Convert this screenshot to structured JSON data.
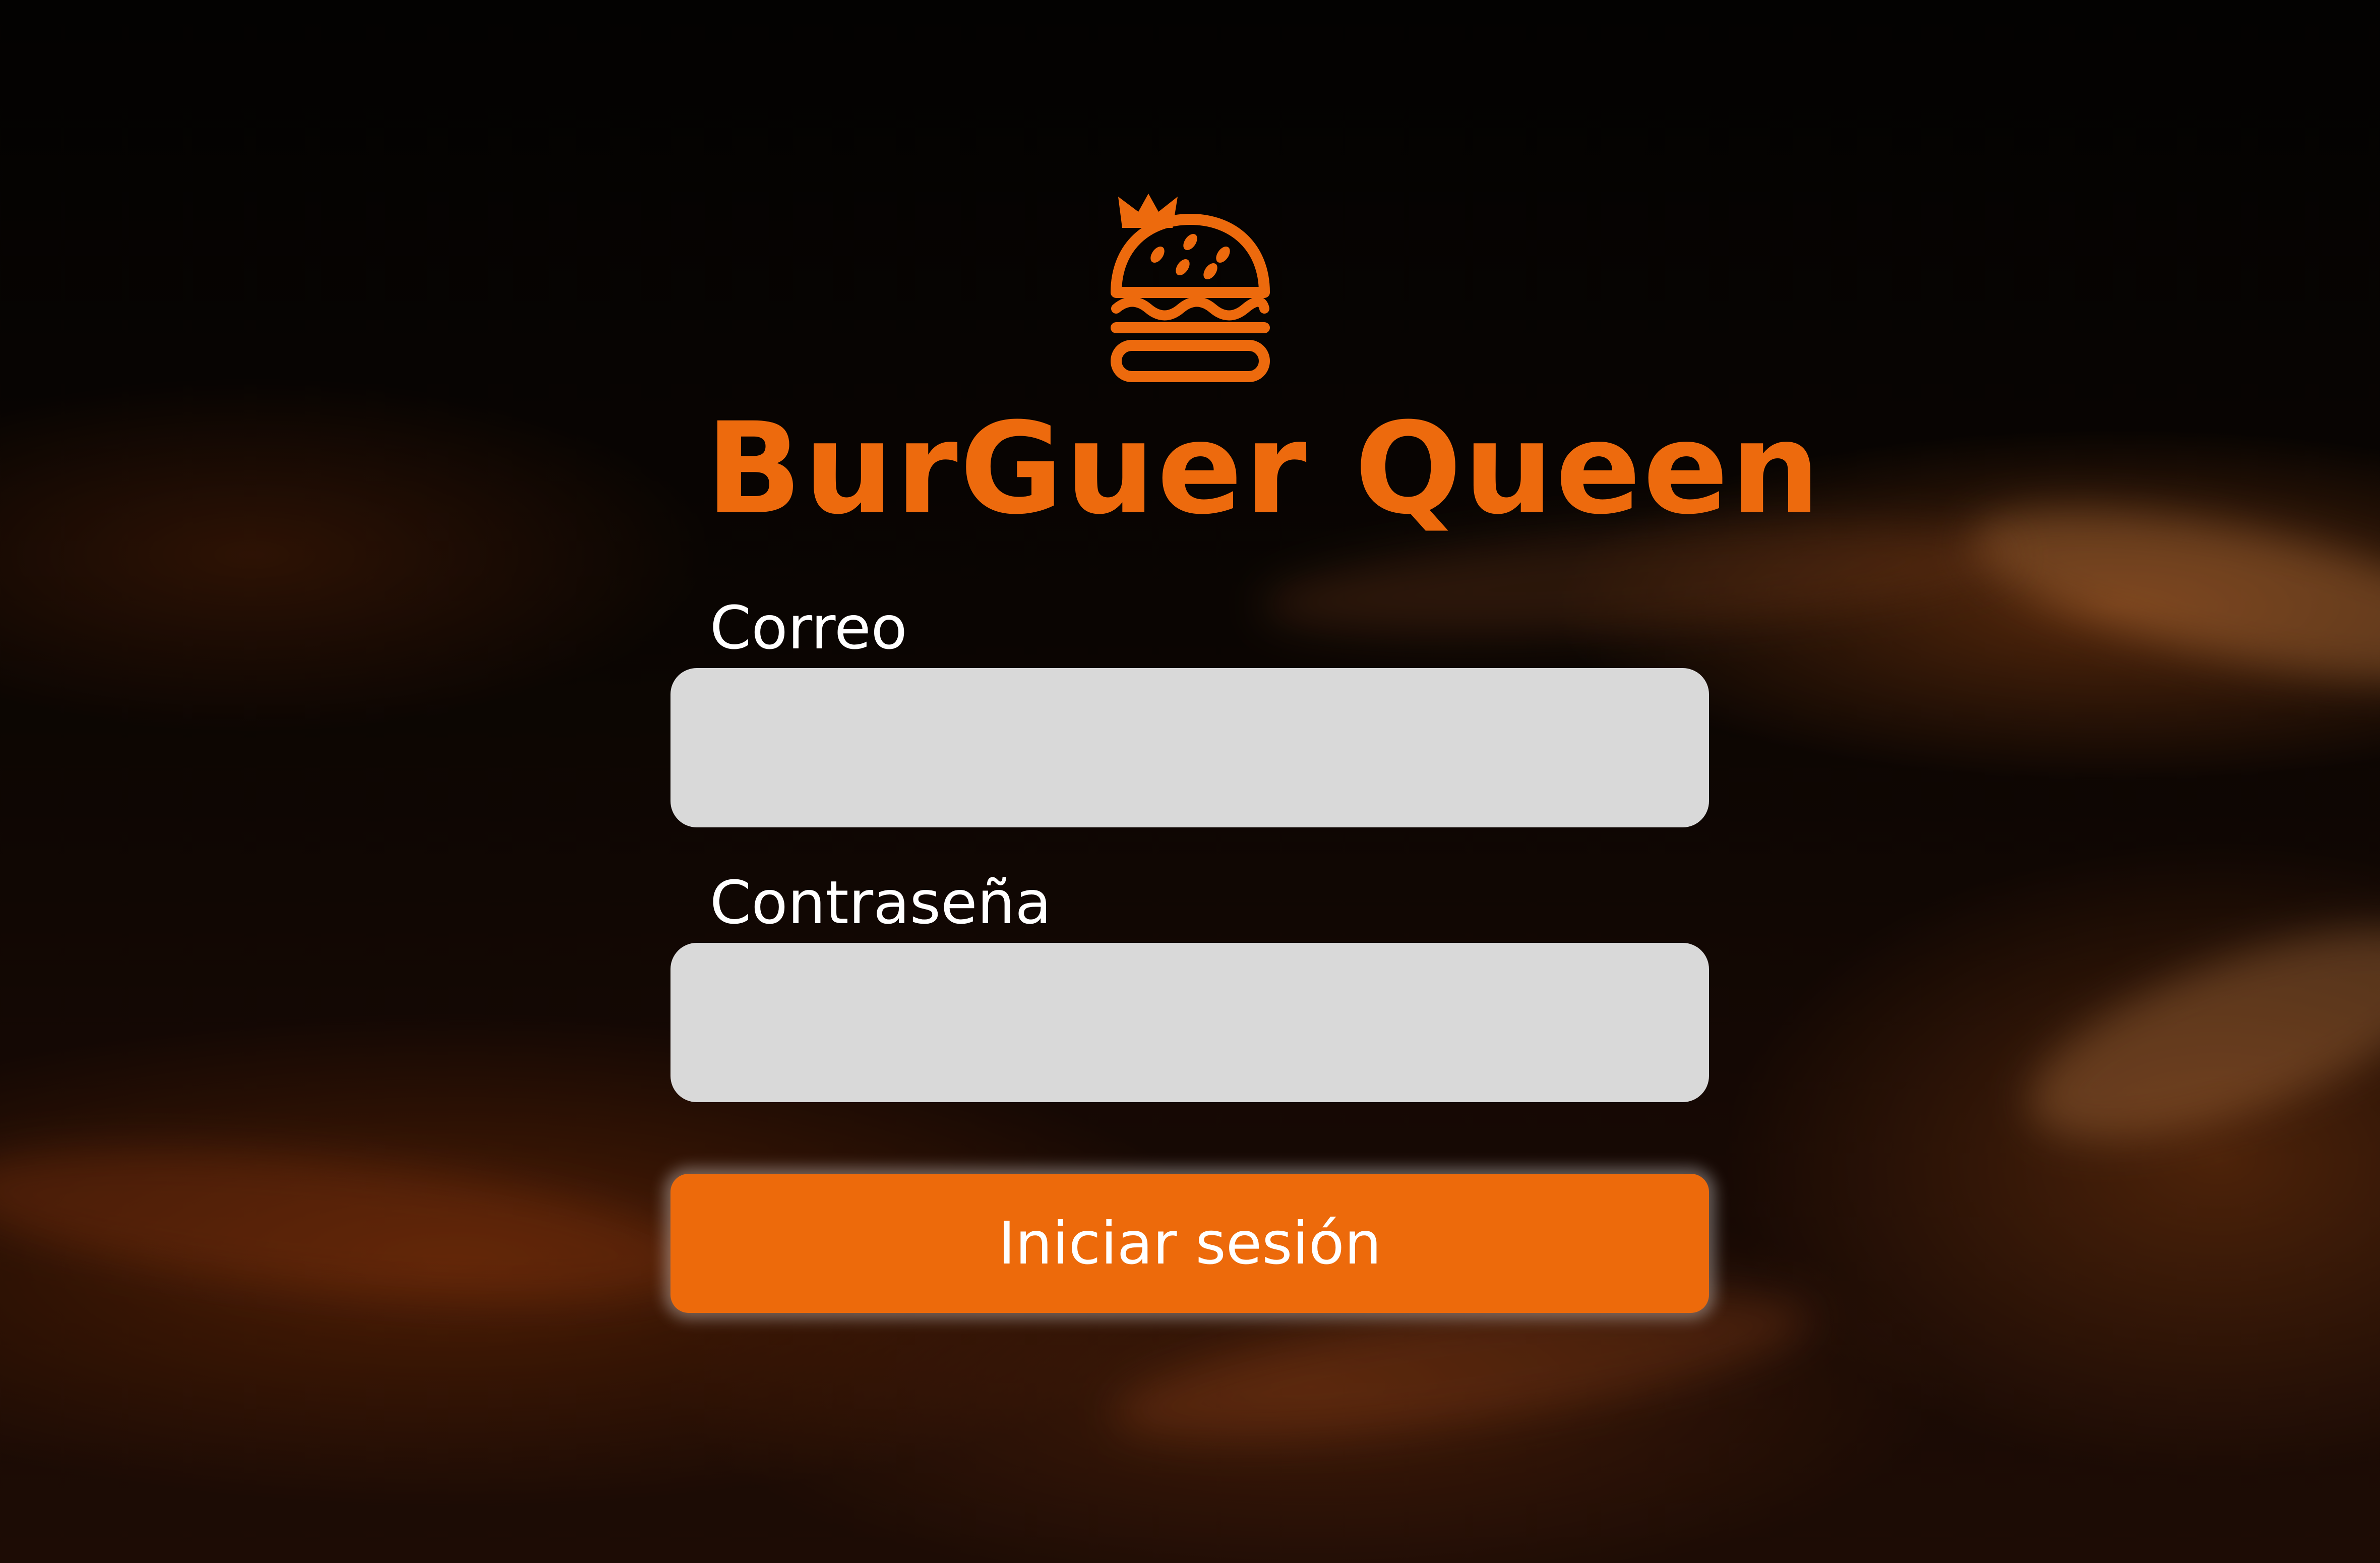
{
  "brand": {
    "name": "BurGuer Queen",
    "icon": "crowned-burger-icon",
    "color": "#ED6A0D"
  },
  "form": {
    "email_label": "Correo",
    "email_value": "",
    "password_label": "Contraseña",
    "password_value": "",
    "submit_label": "Iniciar sesión"
  },
  "theme": {
    "background": "flames-dark",
    "accent": "#ED6A0B",
    "field_background": "#D9D9D9",
    "label_color": "#FFFFFF"
  }
}
